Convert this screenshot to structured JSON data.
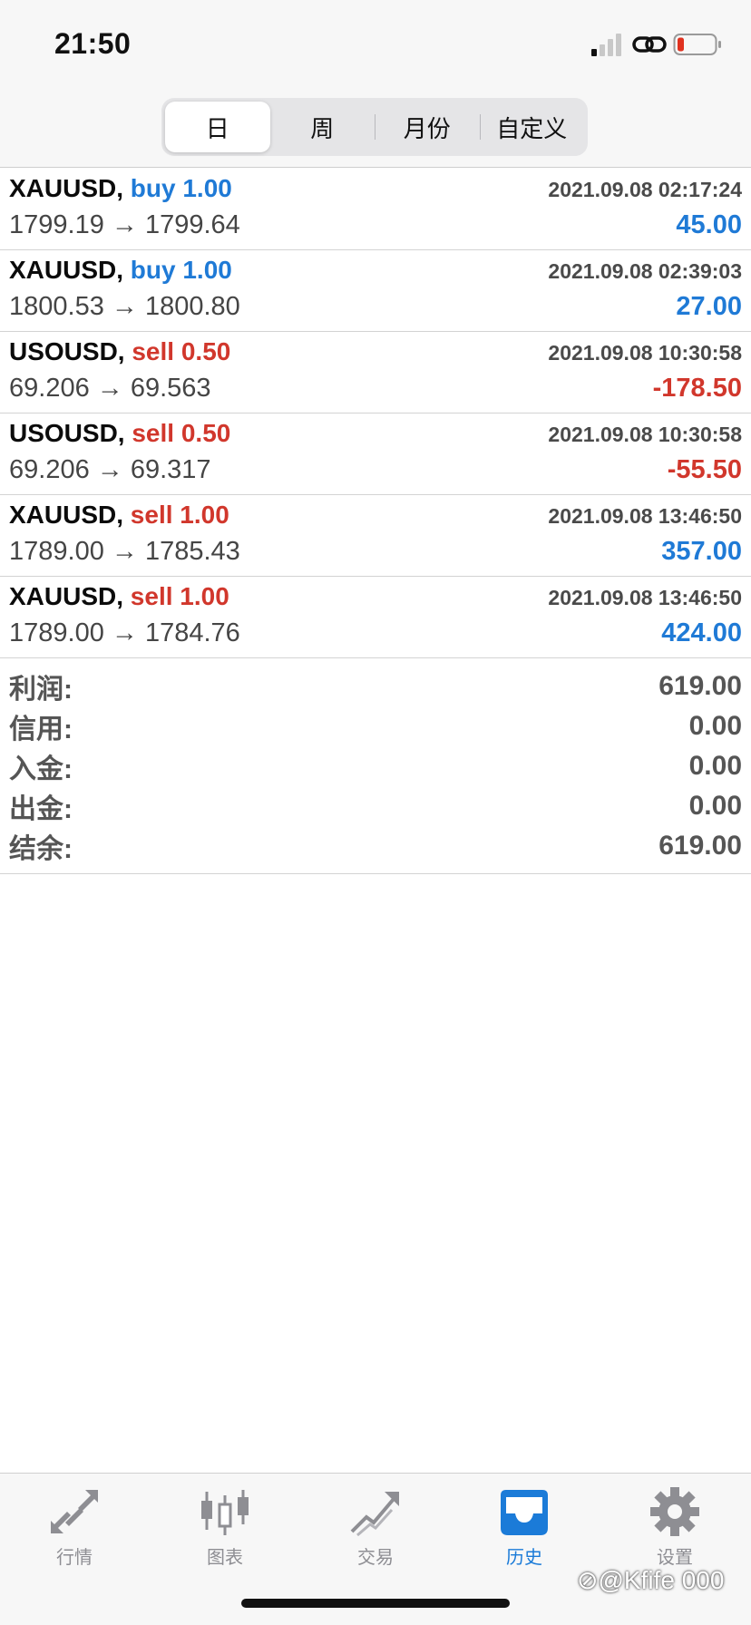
{
  "status_bar": {
    "time": "21:50"
  },
  "tabs_period": [
    {
      "label": "日",
      "active": true
    },
    {
      "label": "周",
      "active": false
    },
    {
      "label": "月份",
      "active": false
    },
    {
      "label": "自定义",
      "active": false
    }
  ],
  "trades": [
    {
      "symbol": "XAUUSD,",
      "side": "buy 1.00",
      "type": "buy",
      "time": "2021.09.08 02:17:24",
      "prices": "1799.19 → 1799.64",
      "profit": "45.00"
    },
    {
      "symbol": "XAUUSD,",
      "side": "buy 1.00",
      "type": "buy",
      "time": "2021.09.08 02:39:03",
      "prices": "1800.53 → 1800.80",
      "profit": "27.00"
    },
    {
      "symbol": "USOUSD,",
      "side": "sell 0.50",
      "type": "sell",
      "time": "2021.09.08 10:30:58",
      "prices": "69.206 → 69.563",
      "profit": "-178.50"
    },
    {
      "symbol": "USOUSD,",
      "side": "sell 0.50",
      "type": "sell",
      "time": "2021.09.08 10:30:58",
      "prices": "69.206 → 69.317",
      "profit": "-55.50"
    },
    {
      "symbol": "XAUUSD,",
      "side": "sell 1.00",
      "type": "sell",
      "time": "2021.09.08 13:46:50",
      "prices": "1789.00 → 1785.43",
      "profit": "357.00"
    },
    {
      "symbol": "XAUUSD,",
      "side": "sell 1.00",
      "type": "sell",
      "time": "2021.09.08 13:46:50",
      "prices": "1789.00 → 1784.76",
      "profit": "424.00"
    }
  ],
  "summary": [
    {
      "label": "利润:",
      "value": "619.00"
    },
    {
      "label": "信用:",
      "value": "0.00"
    },
    {
      "label": "入金:",
      "value": "0.00"
    },
    {
      "label": "出金:",
      "value": "0.00"
    },
    {
      "label": "结余:",
      "value": "619.00"
    }
  ],
  "bottom_tabs": [
    {
      "label": "行情",
      "icon": "quotes-arrows-icon",
      "active": false
    },
    {
      "label": "图表",
      "icon": "candlestick-chart-icon",
      "active": false
    },
    {
      "label": "交易",
      "icon": "trade-trend-icon",
      "active": false
    },
    {
      "label": "历史",
      "icon": "history-inbox-icon",
      "active": true
    },
    {
      "label": "设置",
      "icon": "gear-icon",
      "active": false
    }
  ],
  "watermark": "⊘@Kfife 000",
  "colors": {
    "buy": "#1f7ad6",
    "sell": "#d1372c",
    "active_tab": "#1b7bd8",
    "inactive_tab": "#8e8e93"
  }
}
